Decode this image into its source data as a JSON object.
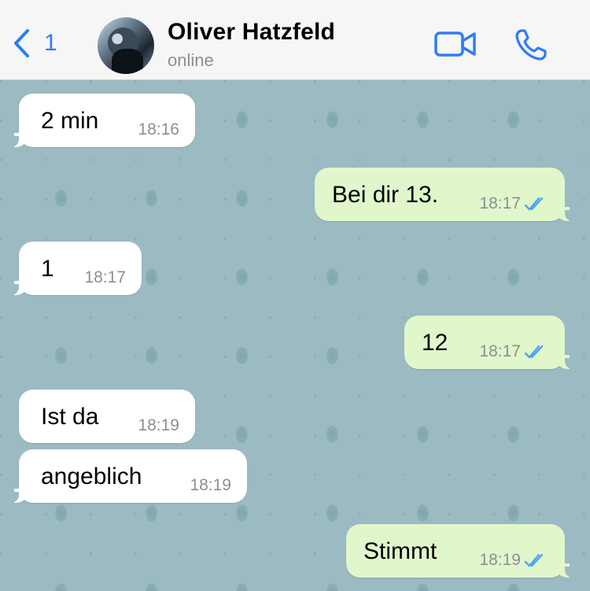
{
  "header": {
    "back_count": "1",
    "contact_name": "Oliver Hatzfeld",
    "contact_status": "online",
    "icons": {
      "back": "chevron-left-icon",
      "video": "video-camera-icon",
      "voice": "phone-icon"
    },
    "accent_color": "#2f7cf6"
  },
  "messages": [
    {
      "direction": "in",
      "text": "2 min",
      "time": "18:16"
    },
    {
      "direction": "out",
      "text": "Bei dir 13.",
      "time": "18:17",
      "status": "read"
    },
    {
      "direction": "in",
      "text": "1",
      "time": "18:17"
    },
    {
      "direction": "out",
      "text": "12",
      "time": "18:17",
      "status": "read"
    },
    {
      "direction": "in",
      "text": "Ist da",
      "time": "18:19"
    },
    {
      "direction": "in",
      "text": "angeblich",
      "time": "18:19"
    },
    {
      "direction": "out",
      "text": "Stimmt",
      "time": "18:19",
      "status": "read"
    }
  ],
  "colors": {
    "incoming_bubble": "#ffffff",
    "outgoing_bubble": "#e1f7cb",
    "read_ticks": "#4fa3f7",
    "timestamp": "#8e8e93"
  }
}
